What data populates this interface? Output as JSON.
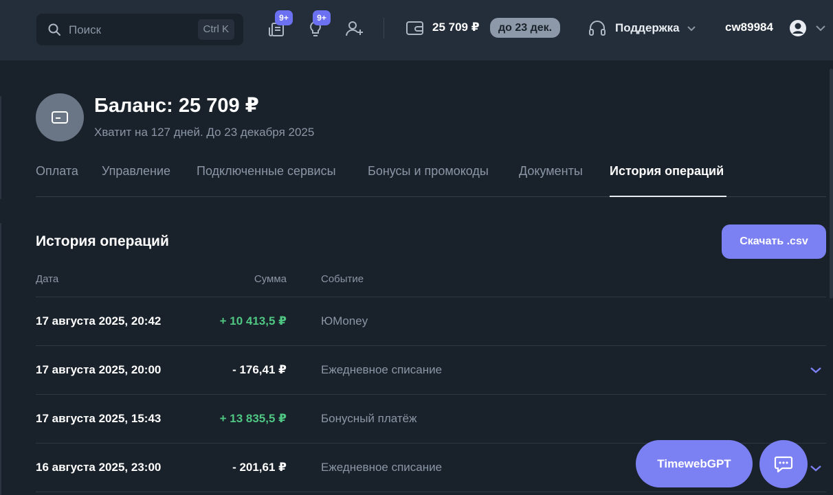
{
  "header": {
    "search_placeholder": "Поиск",
    "search_shortcut": "Ctrl K",
    "notifications_badge": "9+",
    "ideas_badge": "9+",
    "balance": "25 709 ₽",
    "balance_until": "до 23 дек.",
    "support_label": "Поддержка",
    "username": "cw89984"
  },
  "balance": {
    "title": "Баланс: 25 709 ₽",
    "subtitle": "Хватит на 127 дней. До 23 декабря 2025"
  },
  "tabs": [
    {
      "label": "Оплата",
      "active": false
    },
    {
      "label": "Управление",
      "active": false
    },
    {
      "label": "Подключенные сервисы",
      "active": false
    },
    {
      "label": "Бонусы и промокоды",
      "active": false
    },
    {
      "label": "Документы",
      "active": false
    },
    {
      "label": "История операций",
      "active": true
    }
  ],
  "history": {
    "title": "История операций",
    "download_label": "Скачать .csv",
    "columns": {
      "date": "Дата",
      "sum": "Сумма",
      "event": "Событие"
    },
    "rows": [
      {
        "date": "17 августа 2025, 20:42",
        "sum": "+ 10 413,5 ₽",
        "event": "ЮMoney",
        "positive": true,
        "expandable": false
      },
      {
        "date": "17 августа 2025, 20:00",
        "sum": "- 176,41 ₽",
        "event": "Ежедневное списание",
        "positive": false,
        "expandable": true
      },
      {
        "date": "17 августа 2025, 15:43",
        "sum": "+ 13 835,5 ₽",
        "event": "Бонусный платёж",
        "positive": true,
        "expandable": false
      },
      {
        "date": "16 августа 2025, 23:00",
        "sum": "- 201,61 ₽",
        "event": "Ежедневное списание",
        "positive": false,
        "expandable": true
      }
    ]
  },
  "floating": {
    "gpt_label": "TimewebGPT"
  },
  "colors": {
    "background": "#19212a",
    "topbar": "#242e3a",
    "accent": "#7b80f3",
    "positive": "#4fc783",
    "muted": "#8b97a6"
  }
}
